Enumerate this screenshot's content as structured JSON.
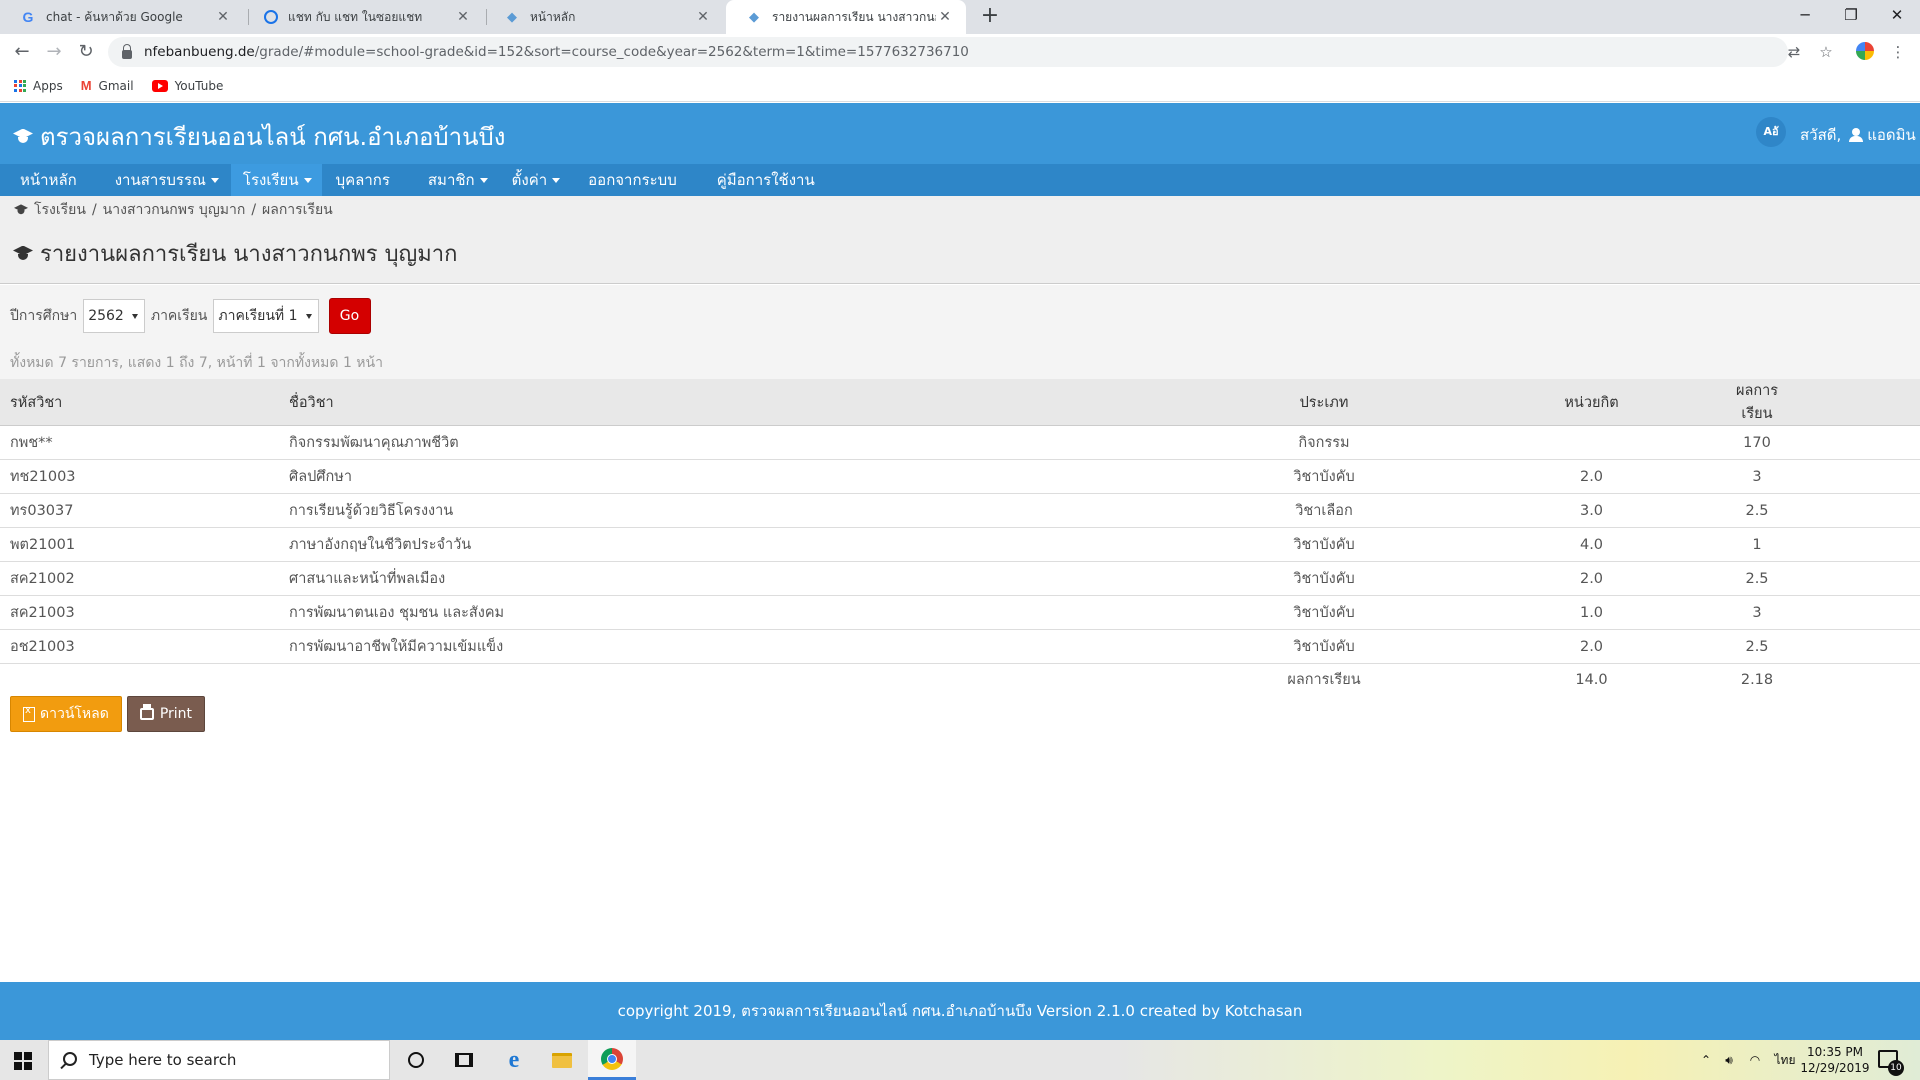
{
  "browser": {
    "tabs": [
      {
        "title": "chat - ค้นหาด้วย Google",
        "favicon": "google-icon",
        "active": false
      },
      {
        "title": "แชท กับ แชท ในซอยแชท",
        "favicon": "chat-icon",
        "active": false
      },
      {
        "title": "หน้าหลัก",
        "favicon": "elephant-icon",
        "active": false
      },
      {
        "title": "รายงานผลการเรียน นางสาวกนกพร บุ",
        "favicon": "elephant-icon",
        "active": true
      }
    ],
    "url_host": "nfebanbueng.de",
    "url_rest": "/grade/#module=school-grade&id=152&sort=course_code&year=2562&term=1&time=1577632736710",
    "bookmarks": [
      {
        "label": "Apps",
        "icon": "apps-grid-icon"
      },
      {
        "label": "Gmail",
        "icon": "gmail-icon"
      },
      {
        "label": "YouTube",
        "icon": "youtube-icon"
      }
    ]
  },
  "site": {
    "title": "ตรวจผลการเรียนออนไลน์ กศน.อำเภอบ้านบึง",
    "lang_badge": "Aอั",
    "greeting": "สวัสดี,",
    "username": "แอดมิน",
    "menu": [
      {
        "label": "หน้าหลัก",
        "dropdown": false,
        "active": false
      },
      {
        "label": "งานสารบรรณ",
        "dropdown": true,
        "active": false
      },
      {
        "label": "โรงเรียน",
        "dropdown": true,
        "active": true
      },
      {
        "label": "บุคลากร",
        "dropdown": false,
        "active": false
      },
      {
        "label": "สมาชิก",
        "dropdown": true,
        "active": false
      },
      {
        "label": "ตั้งค่า",
        "dropdown": true,
        "active": false
      },
      {
        "label": "ออกจากระบบ",
        "dropdown": false,
        "active": false
      },
      {
        "label": "คู่มือการใช้งาน",
        "dropdown": false,
        "active": false
      }
    ],
    "breadcrumb": [
      "โรงเรียน",
      "นางสาวกนกพร บุญมาก",
      "ผลการเรียน"
    ],
    "page_title": "รายงานผลการเรียน นางสาวกนกพร บุญมาก",
    "filter": {
      "year_label": "ปีการศึกษา",
      "year_value": "2562",
      "term_label": "ภาคเรียน",
      "term_value": "ภาคเรียนที่ 1",
      "go_label": "Go"
    },
    "summary": "ทั้งหมด 7 รายการ, แสดง 1 ถึง 7, หน้าที่ 1 จากทั้งหมด 1 หน้า",
    "table": {
      "headers": [
        "รหัสวิชา",
        "ชื่อวิชา",
        "ประเภท",
        "หน่วยกิต",
        "ผลการเรียน"
      ],
      "rows": [
        [
          "กพช**",
          "กิจกรรมพัฒนาคุณภาพชีวิต",
          "กิจกรรม",
          "",
          "170"
        ],
        [
          "ทช21003",
          "ศิลปศึกษา",
          "วิชาบังคับ",
          "2.0",
          "3"
        ],
        [
          "ทร03037",
          "การเรียนรู้ด้วยวิธีโครงงาน",
          "วิชาเลือก",
          "3.0",
          "2.5"
        ],
        [
          "พต21001",
          "ภาษาอังกฤษในชีวิตประจำวัน",
          "วิชาบังคับ",
          "4.0",
          "1"
        ],
        [
          "สค21002",
          "ศาสนาและหน้าที่พลเมือง",
          "วิชาบังคับ",
          "2.0",
          "2.5"
        ],
        [
          "สค21003",
          "การพัฒนาตนเอง ชุมชน และสังคม",
          "วิชาบังคับ",
          "1.0",
          "3"
        ],
        [
          "อช21003",
          "การพัฒนาอาชีพให้มีความเข้มแข็ง",
          "วิชาบังคับ",
          "2.0",
          "2.5"
        ]
      ],
      "total_label": "ผลการเรียน",
      "total_credits": "14.0",
      "total_grade": "2.18"
    },
    "download_label": "ดาวน์โหลด",
    "print_label": "Print",
    "footer": "copyright 2019, ตรวจผลการเรียนออนไลน์ กศน.อำเภอบ้านบึง Version 2.1.0 created by Kotchasan"
  },
  "taskbar": {
    "search_placeholder": "Type here to search",
    "ime": "ไทย",
    "time": "10:35 PM",
    "date": "12/29/2019",
    "notification_count": "10"
  },
  "colors": {
    "header_blue": "#3b97d9",
    "menu_blue": "#2e86c8",
    "go_red": "#d40000",
    "download_orange": "#f29c0f",
    "print_brown": "#7a5c4f"
  }
}
